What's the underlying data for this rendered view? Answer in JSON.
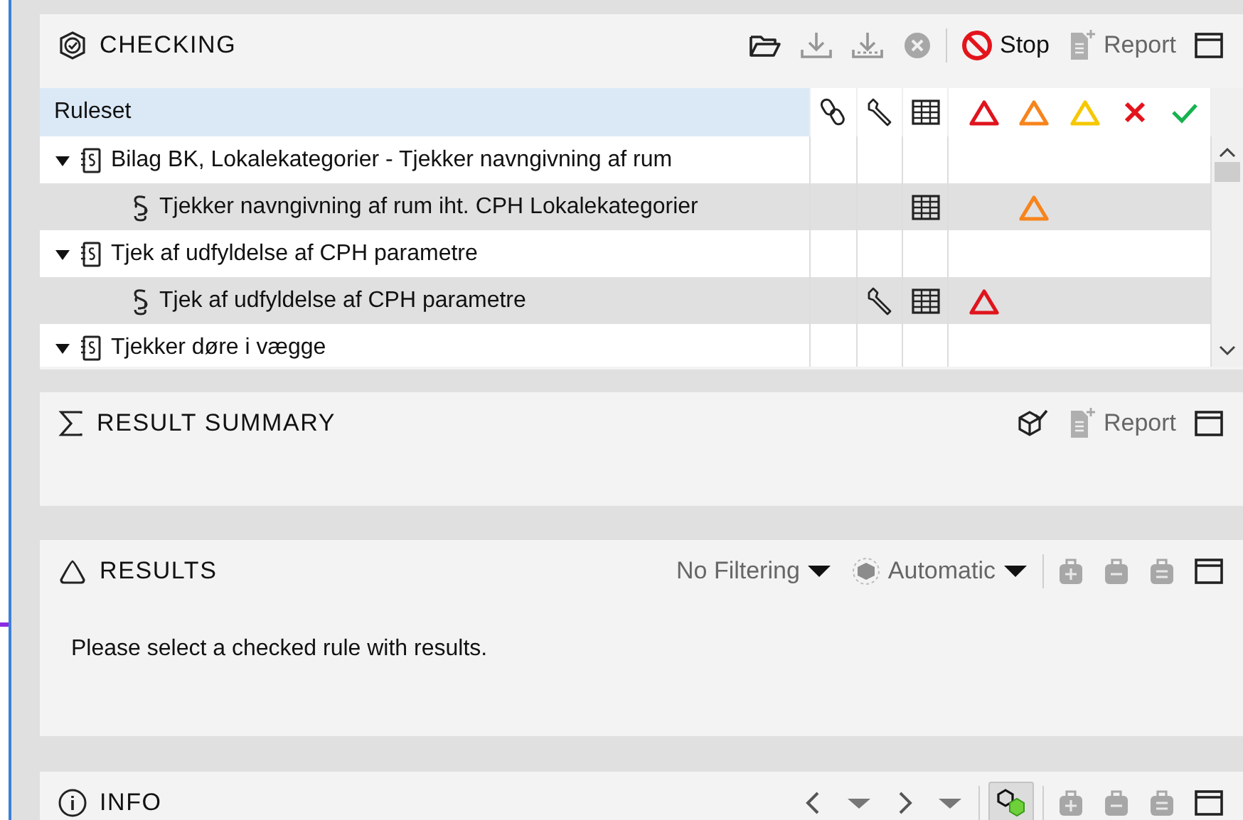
{
  "checking": {
    "title": "CHECKING",
    "tools": [
      {
        "kind": "open",
        "disabled": false
      },
      {
        "kind": "download",
        "disabled": true
      },
      {
        "kind": "download-all",
        "disabled": true
      },
      {
        "kind": "cancel",
        "disabled": true
      },
      {
        "kind": "separator"
      },
      {
        "kind": "stop",
        "label": "Stop",
        "disabled": false
      },
      {
        "kind": "report",
        "label": "Report",
        "disabled": true
      },
      {
        "kind": "maximize",
        "disabled": false
      }
    ],
    "table": {
      "ruleset_header": "Ruleset",
      "result_columns": [
        {
          "kind": "critical"
        },
        {
          "kind": "major"
        },
        {
          "kind": "minor"
        },
        {
          "kind": "error"
        },
        {
          "kind": "passed"
        }
      ],
      "rows": [
        {
          "kind": "group",
          "expanded": true,
          "label": "Bilag BK, Lokalekategorier - Tjekker navngivning af rum",
          "wrench": false,
          "table": false,
          "results": []
        },
        {
          "kind": "rule",
          "label": "Tjekker navngivning af rum iht. CPH Lokalekategorier",
          "wrench": false,
          "table": true,
          "results": [
            {
              "kind": "major"
            }
          ]
        },
        {
          "kind": "group",
          "expanded": true,
          "label": "Tjek af udfyldelse af CPH parametre",
          "wrench": false,
          "table": false,
          "results": []
        },
        {
          "kind": "rule",
          "label": "Tjek af udfyldelse af CPH parametre",
          "wrench": true,
          "table": true,
          "results": [
            {
              "kind": "critical"
            }
          ]
        },
        {
          "kind": "group",
          "expanded": true,
          "label": "Tjekker døre i vægge",
          "wrench": false,
          "table": false,
          "results": []
        }
      ]
    }
  },
  "result_summary": {
    "title": "RESULT SUMMARY",
    "tools": [
      {
        "kind": "summary",
        "disabled": false
      },
      {
        "kind": "report",
        "label": "Report",
        "disabled": true
      },
      {
        "kind": "maximize",
        "disabled": false
      }
    ]
  },
  "results": {
    "title": "RESULTS",
    "message": "Please select a checked rule with results.",
    "tools": [
      {
        "kind": "filter",
        "label": "No Filtering",
        "disabled": false
      },
      {
        "kind": "auto",
        "label": "Automatic",
        "disabled": false
      },
      {
        "kind": "separator"
      },
      {
        "kind": "bag-add",
        "disabled": true
      },
      {
        "kind": "bag-remove",
        "disabled": true
      },
      {
        "kind": "bag-clear",
        "disabled": true
      },
      {
        "kind": "maximize",
        "disabled": false
      }
    ]
  },
  "info": {
    "title": "INFO",
    "tools": [
      {
        "kind": "back",
        "disabled": false
      },
      {
        "kind": "menu",
        "disabled": false
      },
      {
        "kind": "forward",
        "disabled": false
      },
      {
        "kind": "menu",
        "disabled": false
      },
      {
        "kind": "separator"
      },
      {
        "kind": "zoom",
        "disabled": false,
        "on": true
      },
      {
        "kind": "separator"
      },
      {
        "kind": "bag-add",
        "disabled": true
      },
      {
        "kind": "bag-remove",
        "disabled": true
      },
      {
        "kind": "bag-clear",
        "disabled": true
      },
      {
        "kind": "maximize",
        "disabled": false
      }
    ]
  }
}
